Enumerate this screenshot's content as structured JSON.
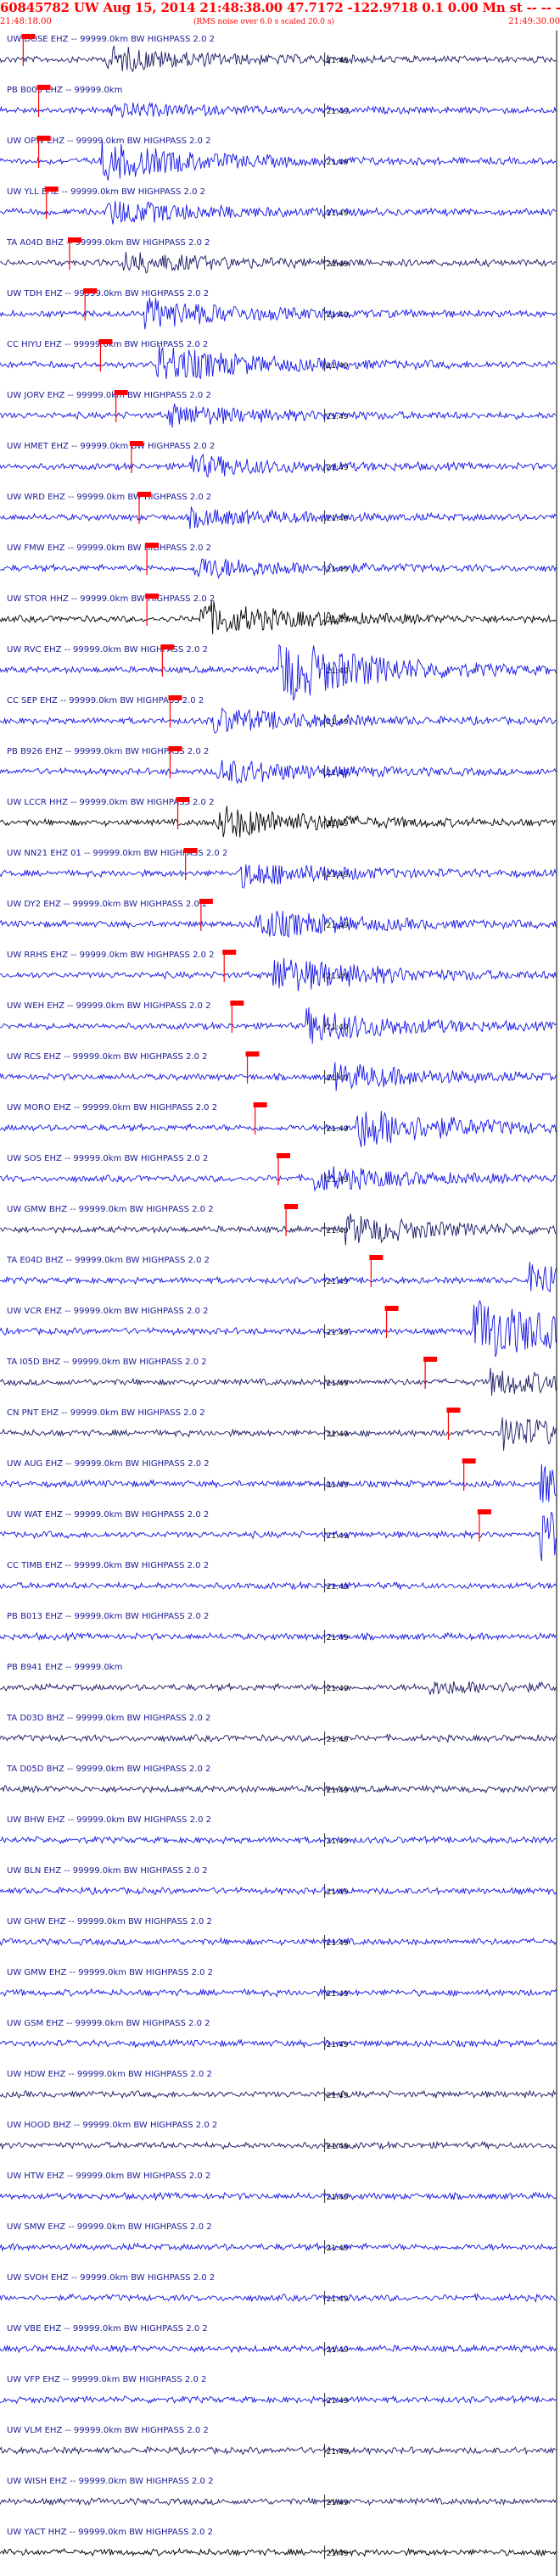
{
  "header": {
    "title": "60845782 UW Aug 15, 2014 21:48:38.00   47.7172 -122.9718  0.1 0.00 Mn st -- -- --   -1",
    "start_time": "21:48:18.00",
    "end_time": "21:49:30.00",
    "rms_note": "(RMS noise over 6.0 s scaled 20.0 s)"
  },
  "colors": {
    "background": "#ffffff",
    "trace_blue": "#1414e6",
    "trace_navy": "#1a1a66",
    "trace_black": "#000000",
    "pick_marker": "#ff0000",
    "label_text": "#1a1a9a"
  },
  "chart_data": {
    "type": "seismogram",
    "time_range": [
      "21:48:18.00",
      "21:49:30.00"
    ],
    "time_tick_label": "21:49",
    "traces": [
      {
        "label": "UW DOSE EHZ -- 99999.0km BW  HIGHPASS  2.0  2",
        "color": "navy",
        "pick": "21:48:21",
        "event": 0.19,
        "strength": 0.6
      },
      {
        "label": "PB B005 EHZ -- 99999.0km",
        "color": "blue",
        "pick": "21:48:23",
        "event": 0.2,
        "strength": 0.3
      },
      {
        "label": "UW OPW EHZ -- 99999.0km BW  HIGHPASS  2.0  2",
        "color": "blue",
        "pick": "21:48:23",
        "event": 0.18,
        "strength": 0.9
      },
      {
        "label": "UW YLL EHZ -- 99999.0km BW  HIGHPASS  2.0  2",
        "color": "blue",
        "pick": "21:48:24",
        "event": 0.19,
        "strength": 0.6
      },
      {
        "label": "TA A04D BHZ -- 99999.0km BW  HIGHPASS  2.0  2",
        "color": "navy",
        "pick": "21:48:27",
        "event": 0.22,
        "strength": 0.5
      },
      {
        "label": "UW TDH EHZ -- 99999.0km BW  HIGHPASS  2.0  2",
        "color": "blue",
        "pick": "21:48:29",
        "event": 0.26,
        "strength": 0.7
      },
      {
        "label": "CC HIYU EHZ -- 99999.0km BW  HIGHPASS  2.0  2",
        "color": "blue",
        "pick": "21:48:31",
        "event": 0.28,
        "strength": 0.9
      },
      {
        "label": "UW JORV EHZ -- 99999.0km BW  HIGHPASS  2.0  2",
        "color": "blue",
        "pick": "21:48:33",
        "event": 0.3,
        "strength": 0.5
      },
      {
        "label": "UW HMET EHZ -- 99999.0km BW  HIGHPASS  2.0  2",
        "color": "blue",
        "pick": "21:48:35",
        "event": 0.34,
        "strength": 0.5
      },
      {
        "label": "UW WRD EHZ -- 99999.0km BW  HIGHPASS  2.0  2",
        "color": "blue",
        "pick": "21:48:36",
        "event": 0.34,
        "strength": 0.4
      },
      {
        "label": "UW FMW EHZ -- 99999.0km BW  HIGHPASS  2.0  2",
        "color": "blue",
        "pick": "21:48:37",
        "event": 0.35,
        "strength": 0.5
      },
      {
        "label": "UW STOR HHZ -- 99999.0km BW  HIGHPASS  2.0  2",
        "color": "black",
        "pick": "21:48:37",
        "event": 0.36,
        "strength": 0.8
      },
      {
        "label": "UW RVC EHZ -- 99999.0km BW  HIGHPASS  2.0  2",
        "color": "blue",
        "pick": "21:48:39",
        "event": 0.5,
        "strength": 1.6
      },
      {
        "label": "CC SEP EHZ -- 99999.0km BW  HIGHPASS  2.0  2",
        "color": "blue",
        "pick": "21:48:40",
        "event": 0.38,
        "strength": 0.6
      },
      {
        "label": "PB B926 EHZ -- 99999.0km BW  HIGHPASS  2.0  2",
        "color": "blue",
        "pick": "21:48:40",
        "event": 0.39,
        "strength": 0.6
      },
      {
        "label": "UW LCCR HHZ -- 99999.0km BW  HIGHPASS  2.0  2",
        "color": "black",
        "pick": "21:48:41",
        "event": 0.39,
        "strength": 0.8
      },
      {
        "label": "UW NN21 EHZ 01 -- 99999.0km BW  HIGHPASS  2.0  2",
        "color": "blue",
        "pick": "21:48:42",
        "event": 0.43,
        "strength": 0.6
      },
      {
        "label": "UW DY2 EHZ -- 99999.0km BW  HIGHPASS  2.0  2",
        "color": "blue",
        "pick": "21:48:44",
        "event": 0.46,
        "strength": 0.7
      },
      {
        "label": "UW RRHS EHZ -- 99999.0km BW  HIGHPASS  2.0  2",
        "color": "blue",
        "pick": "21:48:47",
        "event": 0.49,
        "strength": 0.9
      },
      {
        "label": "UW WEH EHZ -- 99999.0km BW  HIGHPASS  2.0  2",
        "color": "blue",
        "pick": "21:48:48",
        "event": 0.55,
        "strength": 0.8
      },
      {
        "label": "UW RCS EHZ -- 99999.0km BW  HIGHPASS  2.0  2",
        "color": "blue",
        "pick": "21:48:50",
        "event": 0.6,
        "strength": 0.6
      },
      {
        "label": "UW MORO EHZ -- 99999.0km BW  HIGHPASS  2.0  2",
        "color": "blue",
        "pick": "21:48:51",
        "event": 0.64,
        "strength": 1.0
      },
      {
        "label": "UW SOS EHZ -- 99999.0km BW  HIGHPASS  2.0  2",
        "color": "blue",
        "pick": "21:48:54",
        "event": 0.56,
        "strength": 0.6
      },
      {
        "label": "UW GMW BHZ -- 99999.0km BW  HIGHPASS  2.0  2",
        "color": "navy",
        "pick": "21:48:55",
        "event": 0.62,
        "strength": 0.7
      },
      {
        "label": "TA E04D BHZ -- 99999.0km BW  HIGHPASS  2.0  2",
        "color": "blue",
        "pick": "21:49:06",
        "event": 0.95,
        "strength": 0.8
      },
      {
        "label": "UW VCR EHZ -- 99999.0km BW  HIGHPASS  2.0  2",
        "color": "blue",
        "pick": "21:49:08",
        "event": 0.85,
        "strength": 1.6
      },
      {
        "label": "TA I05D BHZ -- 99999.0km BW  HIGHPASS  2.0  2",
        "color": "navy",
        "pick": "21:49:13",
        "event": 0.88,
        "strength": 0.6
      },
      {
        "label": "CN PNT EHZ -- 99999.0km BW  HIGHPASS  2.0  2",
        "color": "navy",
        "pick": "21:49:16",
        "event": 0.9,
        "strength": 0.8
      },
      {
        "label": "UW AUG EHZ -- 99999.0km BW  HIGHPASS  2.0  2",
        "color": "blue",
        "pick": "21:49:18",
        "event": 0.97,
        "strength": 0.9
      },
      {
        "label": "UW WAT EHZ -- 99999.0km BW  HIGHPASS  2.0  2",
        "color": "blue",
        "pick": "21:49:20",
        "event": 0.97,
        "strength": 1.3
      },
      {
        "label": "CC TIMB EHZ -- 99999.0km BW  HIGHPASS  2.0  2",
        "color": "blue",
        "pick": null,
        "event": null,
        "strength": 0
      },
      {
        "label": "PB B013 EHZ -- 99999.0km BW  HIGHPASS  2.0  2",
        "color": "blue",
        "pick": null,
        "event": null,
        "strength": 0
      },
      {
        "label": "PB B941 EHZ -- 99999.0km",
        "color": "navy",
        "pick": null,
        "event": 0.76,
        "strength": 0.3
      },
      {
        "label": "TA D03D BHZ -- 99999.0km BW  HIGHPASS  2.0  2",
        "color": "navy",
        "pick": null,
        "event": null,
        "strength": 0
      },
      {
        "label": "TA D05D BHZ -- 99999.0km BW  HIGHPASS  2.0  2",
        "color": "navy",
        "pick": null,
        "event": null,
        "strength": 0
      },
      {
        "label": "UW BHW EHZ -- 99999.0km BW  HIGHPASS  2.0  2",
        "color": "blue",
        "pick": null,
        "event": null,
        "strength": 0
      },
      {
        "label": "UW BLN EHZ -- 99999.0km BW  HIGHPASS  2.0  2",
        "color": "blue",
        "pick": null,
        "event": null,
        "strength": 0
      },
      {
        "label": "UW GHW EHZ -- 99999.0km BW  HIGHPASS  2.0  2",
        "color": "blue",
        "pick": null,
        "event": null,
        "strength": 0
      },
      {
        "label": "UW GMW EHZ -- 99999.0km BW  HIGHPASS  2.0  2",
        "color": "blue",
        "pick": null,
        "event": null,
        "strength": 0
      },
      {
        "label": "UW GSM EHZ -- 99999.0km BW  HIGHPASS  2.0  2",
        "color": "blue",
        "pick": null,
        "event": null,
        "strength": 0
      },
      {
        "label": "UW HDW EHZ -- 99999.0km BW  HIGHPASS  2.0  2",
        "color": "navy",
        "pick": null,
        "event": null,
        "strength": 0
      },
      {
        "label": "UW HOOD BHZ -- 99999.0km BW  HIGHPASS  2.0  2",
        "color": "navy",
        "pick": null,
        "event": null,
        "strength": 0
      },
      {
        "label": "UW HTW EHZ -- 99999.0km BW  HIGHPASS  2.0  2",
        "color": "blue",
        "pick": null,
        "event": null,
        "strength": 0
      },
      {
        "label": "UW SMW EHZ -- 99999.0km BW  HIGHPASS  2.0  2",
        "color": "blue",
        "pick": null,
        "event": null,
        "strength": 0
      },
      {
        "label": "UW SVOH EHZ -- 99999.0km BW  HIGHPASS  2.0  2",
        "color": "blue",
        "pick": null,
        "event": null,
        "strength": 0
      },
      {
        "label": "UW VBE EHZ -- 99999.0km BW  HIGHPASS  2.0  2",
        "color": "blue",
        "pick": null,
        "event": null,
        "strength": 0
      },
      {
        "label": "UW VFP EHZ -- 99999.0km BW  HIGHPASS  2.0  2",
        "color": "blue",
        "pick": null,
        "event": null,
        "strength": 0
      },
      {
        "label": "UW VLM EHZ -- 99999.0km BW  HIGHPASS  2.0  2",
        "color": "navy",
        "pick": null,
        "event": null,
        "strength": 0
      },
      {
        "label": "UW WISH EHZ -- 99999.0km BW  HIGHPASS  2.0  2",
        "color": "navy",
        "pick": null,
        "event": null,
        "strength": 0
      },
      {
        "label": "UW YACT HHZ -- 99999.0km BW  HIGHPASS  2.0  2",
        "color": "black",
        "pick": null,
        "event": null,
        "strength": 0
      }
    ]
  }
}
